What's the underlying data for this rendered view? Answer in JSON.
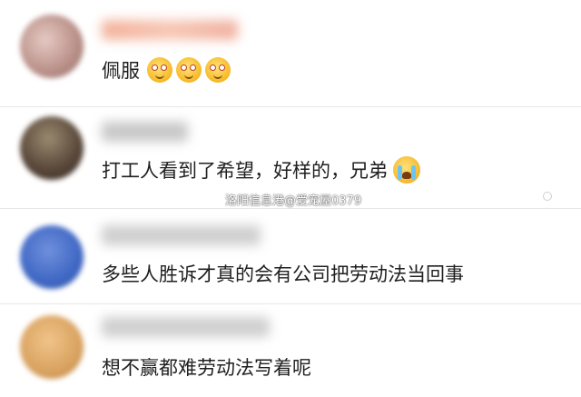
{
  "comments": [
    {
      "text": "佩服",
      "emoji": [
        "sweat-smile-emoji",
        "sweat-smile-emoji",
        "sweat-smile-emoji"
      ]
    },
    {
      "text": "打工人看到了希望，好样的，兄弟",
      "emoji": [
        "crying-emoji"
      ]
    },
    {
      "text": "多些人胜诉才真的会有公司把劳动法当回事",
      "emoji": []
    },
    {
      "text": "想不赢都难劳动法写着呢",
      "emoji": []
    }
  ],
  "watermark": "洛阳信息港@爱宠屋0379",
  "colors": {
    "avatar_1": "#c9a29a",
    "avatar_2": "#5c4a3c",
    "avatar_3": "#3f67c4",
    "avatar_4": "#d9a260"
  }
}
